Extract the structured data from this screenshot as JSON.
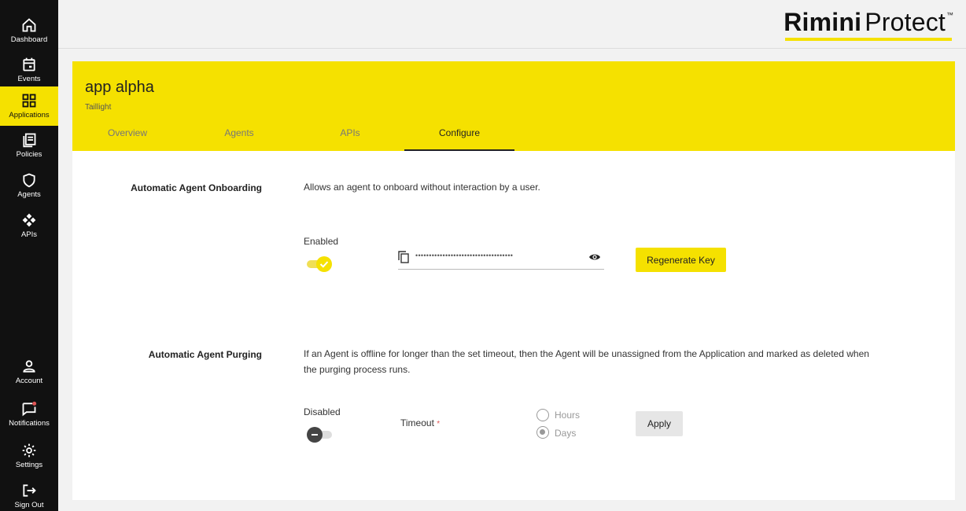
{
  "sidebar": {
    "items": [
      {
        "label": "Dashboard",
        "icon": "home-icon"
      },
      {
        "label": "Events",
        "icon": "calendar-icon"
      },
      {
        "label": "Applications",
        "icon": "grid-icon",
        "active": true
      },
      {
        "label": "Policies",
        "icon": "document-stack-icon"
      },
      {
        "label": "Agents",
        "icon": "shield-icon"
      },
      {
        "label": "APIs",
        "icon": "api-nodes-icon"
      }
    ],
    "bottom_items": [
      {
        "label": "Account",
        "icon": "user-icon"
      },
      {
        "label": "Notifications",
        "icon": "chat-bubble-icon"
      },
      {
        "label": "Settings",
        "icon": "gear-icon"
      },
      {
        "label": "Sign Out",
        "icon": "sign-out-icon"
      }
    ]
  },
  "header": {
    "brand_bold": "Rimini",
    "brand_light": "Protect",
    "brand_tm": "™"
  },
  "app": {
    "title": "app alpha",
    "subtitle": "Taillight",
    "tabs": [
      "Overview",
      "Agents",
      "APIs",
      "Configure"
    ],
    "active_tab": "Configure"
  },
  "onboarding": {
    "label": "Automatic Agent Onboarding",
    "description": "Allows an agent to onboard without interaction by a user.",
    "status_label": "Enabled",
    "enabled": true,
    "key_masked": "••••••••••••••••••••••••••••••••••••",
    "regenerate_label": "Regenerate Key"
  },
  "purging": {
    "label": "Automatic Agent Purging",
    "description": "If an Agent is offline for longer than the set timeout, then the Agent will be unassigned from the Application and marked as deleted when the purging process runs.",
    "status_label": "Disabled",
    "enabled": false,
    "timeout_label": "Timeout",
    "required_mark": "*",
    "options": [
      "Hours",
      "Days"
    ],
    "selected": "Days",
    "apply_label": "Apply"
  },
  "colors": {
    "accent": "#f5e100",
    "sidebar_bg": "#111111",
    "notification_dot": "#e05555"
  }
}
